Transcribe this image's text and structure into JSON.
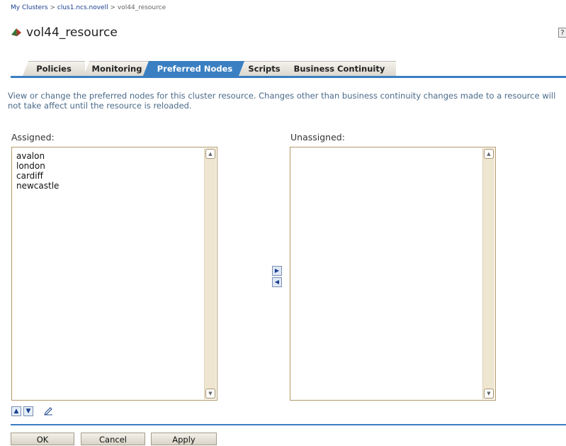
{
  "breadcrumb": {
    "items": [
      "My Clusters",
      "clus1.ncs.novell",
      "vol44_resource"
    ],
    "separator": ">"
  },
  "header": {
    "title": "vol44_resource",
    "help_label": "?"
  },
  "tabs": [
    {
      "label": "Policies",
      "active": false
    },
    {
      "label": "Monitoring",
      "active": false
    },
    {
      "label": "Preferred Nodes",
      "active": true
    },
    {
      "label": "Scripts",
      "active": false
    },
    {
      "label": "Business Continuity",
      "active": false
    }
  ],
  "description": "View or change the preferred nodes for this cluster resource. Changes other than business continuity changes made to a resource will not take affect until the resource is reloaded.",
  "assigned": {
    "label": "Assigned:",
    "items": [
      "avalon",
      "london",
      "cardiff",
      "newcastle"
    ]
  },
  "unassigned": {
    "label": "Unassigned:",
    "items": []
  },
  "buttons": {
    "ok": "OK",
    "cancel": "Cancel",
    "apply": "Apply"
  },
  "colors": {
    "accent": "#3a7fc1",
    "link": "#1a3f8f",
    "description": "#4a6a8a"
  },
  "icons": {
    "title": "cluster-resource-icon",
    "move_right": "arrow-right-icon",
    "move_left": "arrow-left-icon",
    "move_up": "arrow-up-icon",
    "move_down": "arrow-down-icon",
    "edit": "pencil-icon"
  }
}
